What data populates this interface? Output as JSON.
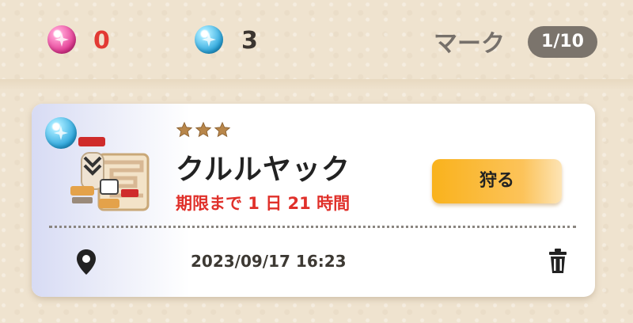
{
  "currency": {
    "pink_count": "0",
    "blue_count": "3"
  },
  "mark": {
    "label": "マーク",
    "badge": "1/10"
  },
  "quest": {
    "stars": 3,
    "name": "クルルヤック",
    "deadline": "期限まで 1 日 21 時間",
    "hunt_button": "狩る",
    "date": "2023/09/17 16:23"
  },
  "colors": {
    "pink_gem": "#e0358f",
    "blue_gem": "#27a3da",
    "deadline_red": "#e0302a",
    "hunt_button": "#f9b21c",
    "badge_bg": "#7b746c"
  },
  "icons": [
    "pink-gem-icon",
    "blue-gem-icon",
    "star-icon",
    "location-pin-icon",
    "trash-icon"
  ]
}
